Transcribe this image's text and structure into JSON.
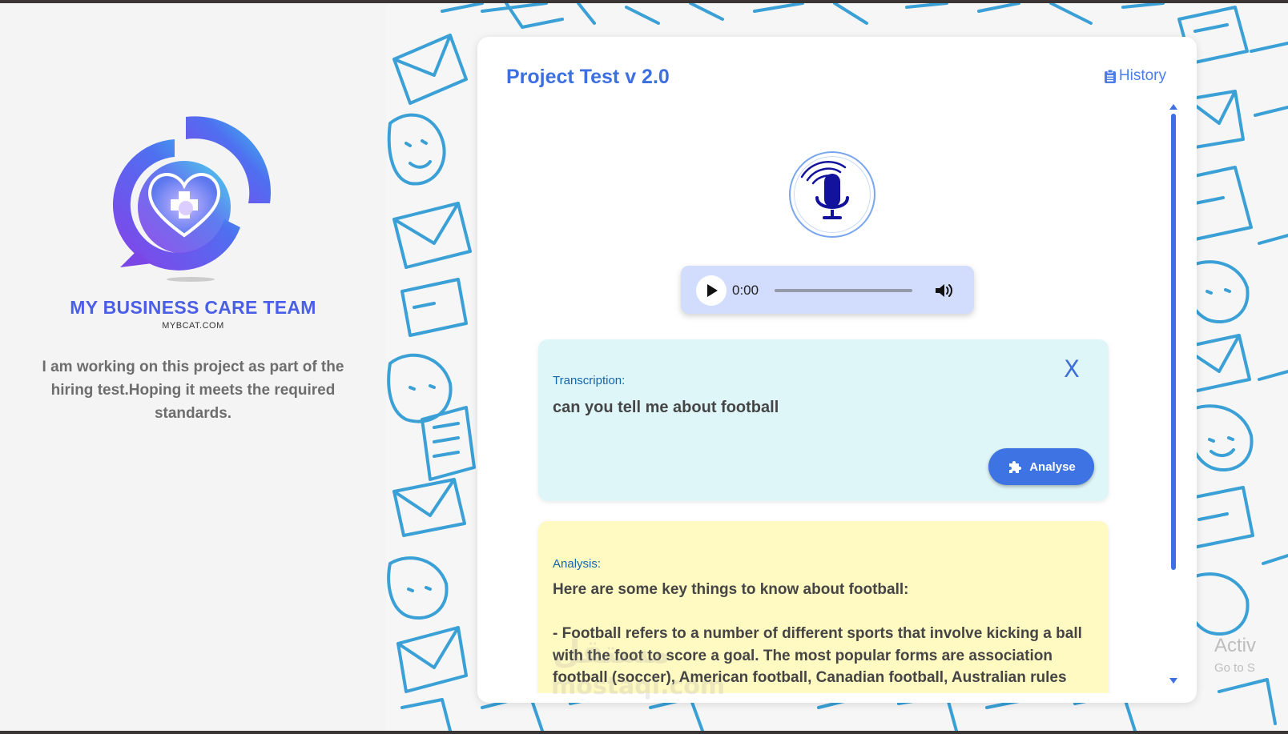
{
  "left_panel": {
    "brand_name": "MY BUSINESS CARE TEAM",
    "brand_url": "MYBCAT.COM",
    "intro": "I am working on this project as part of the hiring test.Hoping it meets the required standards."
  },
  "card": {
    "title": "Project Test v 2.0",
    "history_label": "History",
    "history_icon": "clipboard-list-icon",
    "mic_icon": "microphone-icon"
  },
  "audio_player": {
    "time": "0:00",
    "progress": 0
  },
  "transcription": {
    "label": "Transcription:",
    "text": "can you tell me about football",
    "close_label": "X",
    "analyse_label": "Analyse",
    "analyse_icon": "puzzle-icon"
  },
  "analysis": {
    "label": "Analysis:",
    "text": "Here are some key things to know about football:\n\n- Football refers to a number of different sports that involve kicking a ball with the foot to score a goal. The most popular forms are association football (soccer), American football, Canadian football, Australian rules football and Gaelic football."
  },
  "overlays": {
    "watermark": "مستقل",
    "watermark_sub": "mostaql.com",
    "activate": "Activ",
    "activate_sub": "Go to S"
  },
  "colors": {
    "accent": "#3c6fe0",
    "transcription_bg": "#dff6f9",
    "analysis_bg": "#fff9c2",
    "pattern_line": "#3aa0d6"
  }
}
